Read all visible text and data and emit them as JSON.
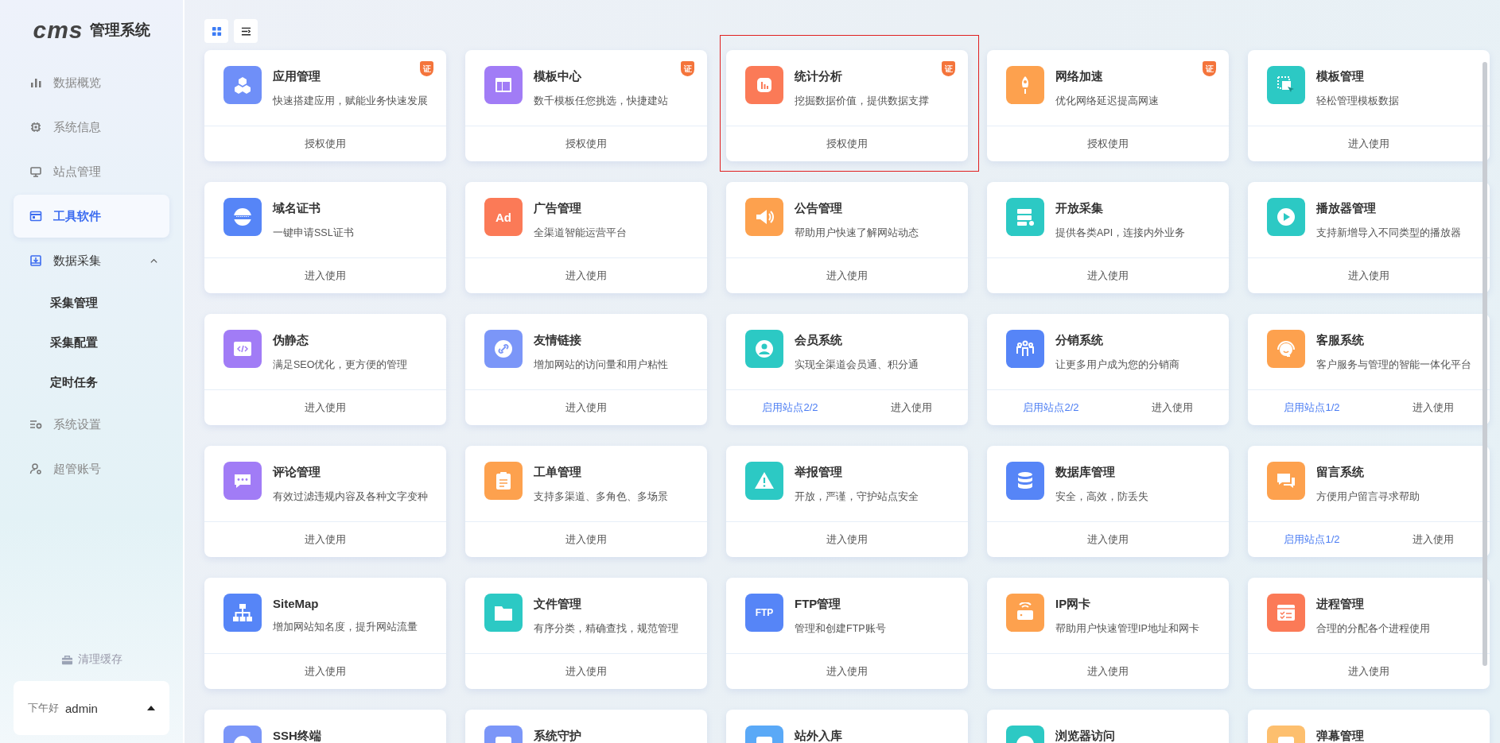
{
  "sidebar": {
    "logo": "cms",
    "title": "管理系统",
    "items": [
      {
        "label": "数据概览",
        "selected": false
      },
      {
        "label": "系统信息",
        "selected": false
      },
      {
        "label": "站点管理",
        "selected": false
      },
      {
        "label": "工具软件",
        "selected": true
      },
      {
        "label": "数据采集",
        "selected": false,
        "expanded": true,
        "children": [
          {
            "label": "采集管理",
            "selected": false
          },
          {
            "label": "采集配置",
            "selected": false
          },
          {
            "label": "定时任务",
            "selected": false
          }
        ]
      },
      {
        "label": "系统设置",
        "selected": false
      },
      {
        "label": "超管账号",
        "selected": false
      }
    ],
    "clear_cache": "清理缓存",
    "greeting": "下午好",
    "user": "admin"
  },
  "toolbar": [
    {
      "kind": "grid",
      "selected": true
    },
    {
      "kind": "list",
      "selected": false
    }
  ],
  "cards": [
    {
      "title": "应用管理",
      "desc": "快速搭建应用，赋能业务快速发展",
      "color": "#6f8ff8",
      "badge": "证",
      "action": "授权使用"
    },
    {
      "title": "模板中心",
      "desc": "数千模板任您挑选，快捷建站",
      "color": "#a17cf6",
      "badge": "证",
      "action": "授权使用"
    },
    {
      "title": "统计分析",
      "desc": "挖掘数据价值，提供数据支撑",
      "color": "#fb7a57",
      "badge": "证",
      "action": "授权使用",
      "highlighted": true
    },
    {
      "title": "网络加速",
      "desc": "优化网络延迟提高网速",
      "color": "#fda14e",
      "badge": "证",
      "action": "授权使用"
    },
    {
      "title": "模板管理",
      "desc": "轻松管理模板数据",
      "color": "#2cc9c4",
      "action": "进入使用"
    },
    {
      "title": "域名证书",
      "desc": "一键申请SSL证书",
      "color": "#5685f7",
      "action": "进入使用"
    },
    {
      "title": "广告管理",
      "desc": "全渠道智能运营平台",
      "color": "#fb7a57",
      "icon_text": "Ad",
      "action": "进入使用"
    },
    {
      "title": "公告管理",
      "desc": "帮助用户快速了解网站动态",
      "color": "#fda14e",
      "action": "进入使用"
    },
    {
      "title": "开放采集",
      "desc": "提供各类API，连接内外业务",
      "color": "#2cc9c4",
      "action": "进入使用"
    },
    {
      "title": "播放器管理",
      "desc": "支持新增导入不同类型的播放器",
      "color": "#2cc9c4",
      "action": "进入使用"
    },
    {
      "title": "伪静态",
      "desc": "满足SEO优化，更方便的管理",
      "color": "#a17cf6",
      "action": "进入使用"
    },
    {
      "title": "友情链接",
      "desc": "增加网站的访问量和用户粘性",
      "color": "#7b96f8",
      "action": "进入使用"
    },
    {
      "title": "会员系统",
      "desc": "实现全渠道会员通、积分通",
      "color": "#2cc9c4",
      "sites": "启用站点2/2",
      "action": "进入使用"
    },
    {
      "title": "分销系统",
      "desc": "让更多用户成为您的分销商",
      "color": "#5685f7",
      "sites": "启用站点2/2",
      "action": "进入使用"
    },
    {
      "title": "客服系统",
      "desc": "客户服务与管理的智能一体化平台",
      "color": "#fda14e",
      "sites": "启用站点1/2",
      "action": "进入使用"
    },
    {
      "title": "评论管理",
      "desc": "有效过滤违规内容及各种文字变种",
      "color": "#a17cf6",
      "action": "进入使用"
    },
    {
      "title": "工单管理",
      "desc": "支持多渠道、多角色、多场景",
      "color": "#fda14e",
      "action": "进入使用"
    },
    {
      "title": "举报管理",
      "desc": "开放，严谨，守护站点安全",
      "color": "#2cc9c4",
      "action": "进入使用"
    },
    {
      "title": "数据库管理",
      "desc": "安全，高效，防丢失",
      "color": "#5685f7",
      "action": "进入使用"
    },
    {
      "title": "留言系统",
      "desc": "方便用户留言寻求帮助",
      "color": "#fda14e",
      "sites": "启用站点1/2",
      "action": "进入使用"
    },
    {
      "title": "SiteMap",
      "desc": "增加网站知名度，提升网站流量",
      "color": "#5685f7",
      "action": "进入使用"
    },
    {
      "title": "文件管理",
      "desc": "有序分类，精确查找，规范管理",
      "color": "#2cc9c4",
      "action": "进入使用"
    },
    {
      "title": "FTP管理",
      "desc": "管理和创建FTP账号",
      "color": "#5685f7",
      "icon_text": "FTP",
      "action": "进入使用"
    },
    {
      "title": "IP网卡",
      "desc": "帮助用户快速管理IP地址和网卡",
      "color": "#fda14e",
      "action": "进入使用"
    },
    {
      "title": "进程管理",
      "desc": "合理的分配各个进程使用",
      "color": "#fb7a57",
      "action": "进入使用"
    },
    {
      "title": "SSH终端",
      "color": "#7b96f8"
    },
    {
      "title": "系统守护",
      "color": "#7b96f8"
    },
    {
      "title": "站外入库",
      "color": "#5aa9f7"
    },
    {
      "title": "浏览器访问",
      "color": "#2cc9c4"
    },
    {
      "title": "弹幕管理",
      "color": "#fdbf6e"
    }
  ]
}
